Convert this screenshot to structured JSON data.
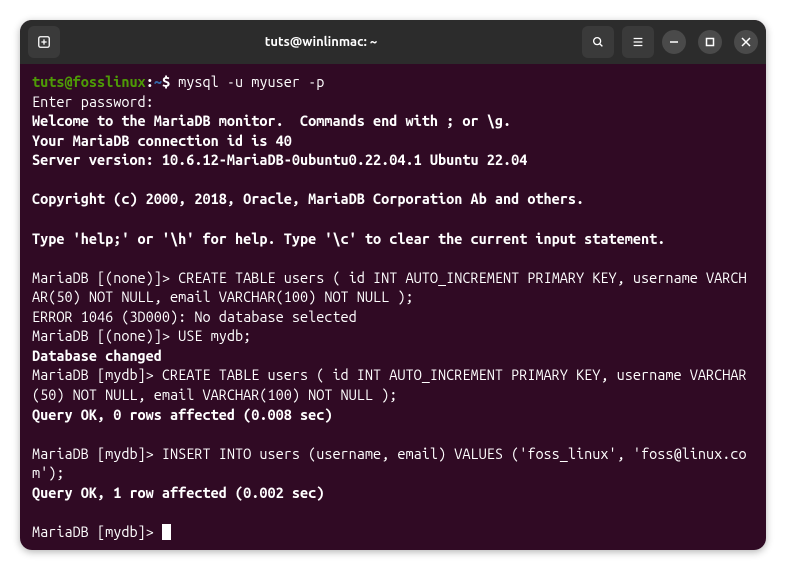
{
  "titlebar": {
    "title": "tuts@winlinmac: ~"
  },
  "prompt": {
    "user_host": "tuts@fosslinux",
    "separator": ":",
    "path": "~",
    "dollar": "$"
  },
  "cmd1": " mysql -u myuser -p",
  "line_enter_password": "Enter password:",
  "line_welcome": "Welcome to the MariaDB monitor.  Commands end with ; or \\g.",
  "line_connection": "Your MariaDB connection id is 40",
  "line_server": "Server version: 10.6.12-MariaDB-0ubuntu0.22.04.1 Ubuntu 22.04",
  "line_copyright": "Copyright (c) 2000, 2018, Oracle, MariaDB Corporation Ab and others.",
  "line_help": "Type 'help;' or '\\h' for help. Type '\\c' to clear the current input statement.",
  "mdb_none_prompt": "MariaDB [(none)]> ",
  "mdb_mydb_prompt": "MariaDB [mydb]> ",
  "stmt_create1": "CREATE TABLE users ( id INT AUTO_INCREMENT PRIMARY KEY, username VARCHAR(50) NOT NULL, email VARCHAR(100) NOT NULL );",
  "error_line": "ERROR 1046 (3D000): No database selected",
  "stmt_use": "USE mydb;",
  "db_changed": "Database changed",
  "stmt_create2": "CREATE TABLE users ( id INT AUTO_INCREMENT PRIMARY KEY, username VARCHAR(50) NOT NULL, email VARCHAR(100) NOT NULL );",
  "query_ok_0": "Query OK, 0 rows affected (0.008 sec)",
  "stmt_insert": "INSERT INTO users (username, email) VALUES ('foss_linux', 'foss@linux.com');",
  "query_ok_1": "Query OK, 1 row affected (0.002 sec)"
}
